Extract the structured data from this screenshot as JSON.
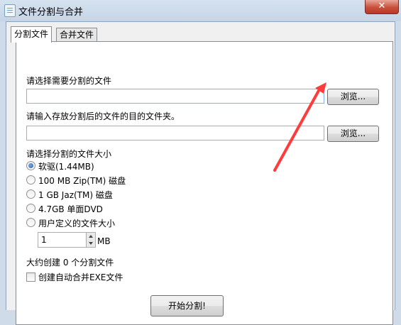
{
  "window": {
    "title": "文件分割与合并",
    "close_label": "✕"
  },
  "tabs": [
    {
      "label": "分割文件",
      "active": true
    },
    {
      "label": "合并文件",
      "active": false
    }
  ],
  "split": {
    "select_file_label": "请选择需要分割的文件",
    "file_path_value": "",
    "browse_label_1": "浏览...",
    "dest_folder_label": "请输入存放分割后的文件的目的文件夹。",
    "dest_path_value": "",
    "browse_label_2": "浏览...",
    "size_label": "请选择分割的文件大小",
    "size_options": [
      {
        "label": "软驱(1.44MB)",
        "checked": true
      },
      {
        "label": "100 MB Zip(TM) 磁盘",
        "checked": false
      },
      {
        "label": "1 GB Jaz(TM) 磁盘",
        "checked": false
      },
      {
        "label": "4.7GB 单面DVD",
        "checked": false
      },
      {
        "label": "用户定义的文件大小",
        "checked": false
      }
    ],
    "custom_size_value": "1",
    "custom_size_unit": "MB",
    "estimate_text": "大约创建 0 个分割文件",
    "auto_merge_label": "创建自动合并EXE文件",
    "auto_merge_checked": false,
    "start_button_label": "开始分割!"
  },
  "annotation": {
    "arrow_color": "#ff3b3b"
  }
}
